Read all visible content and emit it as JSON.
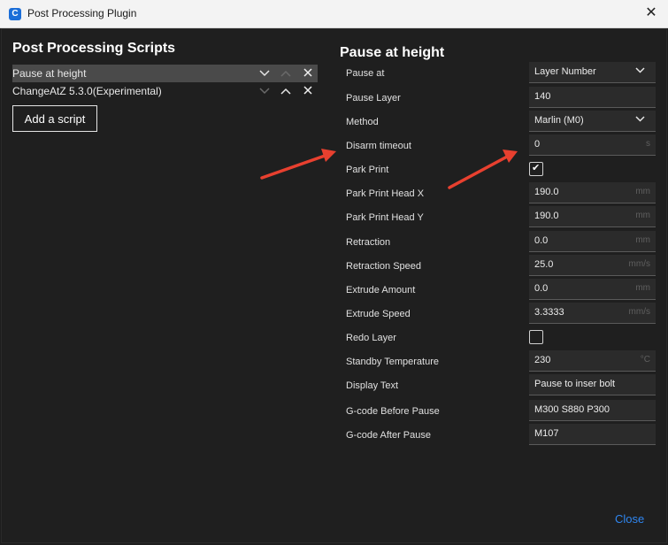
{
  "window": {
    "title": "Post Processing Plugin",
    "app_icon_letter": "C",
    "close_glyph": "✕"
  },
  "left": {
    "heading": "Post Processing Scripts",
    "scripts": [
      {
        "label": "Pause at height",
        "selected": true
      },
      {
        "label": "ChangeAtZ 5.3.0(Experimental)",
        "selected": false
      }
    ],
    "add_button": "Add a script"
  },
  "right": {
    "heading": "Pause at height",
    "params": {
      "pause_at": {
        "label": "Pause at",
        "value": "Layer Number"
      },
      "pause_layer": {
        "label": "Pause Layer",
        "value": "140"
      },
      "method": {
        "label": "Method",
        "value": "Marlin (M0)"
      },
      "disarm_timeout": {
        "label": "Disarm timeout",
        "value": "0",
        "unit": "s"
      },
      "park_print": {
        "label": "Park Print",
        "checked": true
      },
      "park_x": {
        "label": "Park Print Head X",
        "value": "190.0",
        "unit": "mm"
      },
      "park_y": {
        "label": "Park Print Head Y",
        "value": "190.0",
        "unit": "mm"
      },
      "retraction": {
        "label": "Retraction",
        "value": "0.0",
        "unit": "mm"
      },
      "retraction_speed": {
        "label": "Retraction Speed",
        "value": "25.0",
        "unit": "mm/s"
      },
      "extrude_amount": {
        "label": "Extrude Amount",
        "value": "0.0",
        "unit": "mm"
      },
      "extrude_speed": {
        "label": "Extrude Speed",
        "value": "3.3333",
        "unit": "mm/s"
      },
      "redo_layer": {
        "label": "Redo Layer",
        "checked": false
      },
      "standby_temp": {
        "label": "Standby Temperature",
        "value": "230",
        "unit": "°C"
      },
      "display_text": {
        "label": "Display Text",
        "value": "Pause to inser bolt"
      },
      "gcode_before": {
        "label": "G-code Before Pause",
        "value": "M300 S880 P300"
      },
      "gcode_after": {
        "label": "G-code After Pause",
        "value": "M107"
      }
    }
  },
  "footer": {
    "close_label": "Close"
  },
  "colors": {
    "accent": "#2f86f0",
    "annotation_arrow": "#e8402f",
    "panel_bg": "#1f1f1f"
  }
}
